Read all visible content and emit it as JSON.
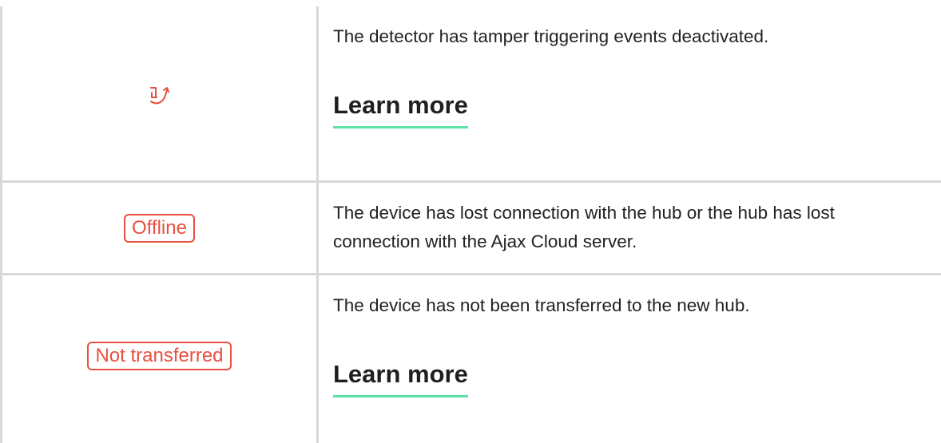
{
  "rows": [
    {
      "indicator_icon": "tamper-deactivated-icon",
      "description": "The detector has tamper triggering events deactivated.",
      "link": "Learn more"
    },
    {
      "badge": "Offline",
      "description": "The device has lost connection with the hub or the hub has lost connection with the Ajax Cloud server."
    },
    {
      "badge": "Not transferred",
      "description": "The device has not been transferred to the new hub.",
      "link": "Learn more"
    }
  ],
  "colors": {
    "status_red": "#e9503f",
    "link_underline": "#5be3a9",
    "border": "#d8d8d8"
  }
}
